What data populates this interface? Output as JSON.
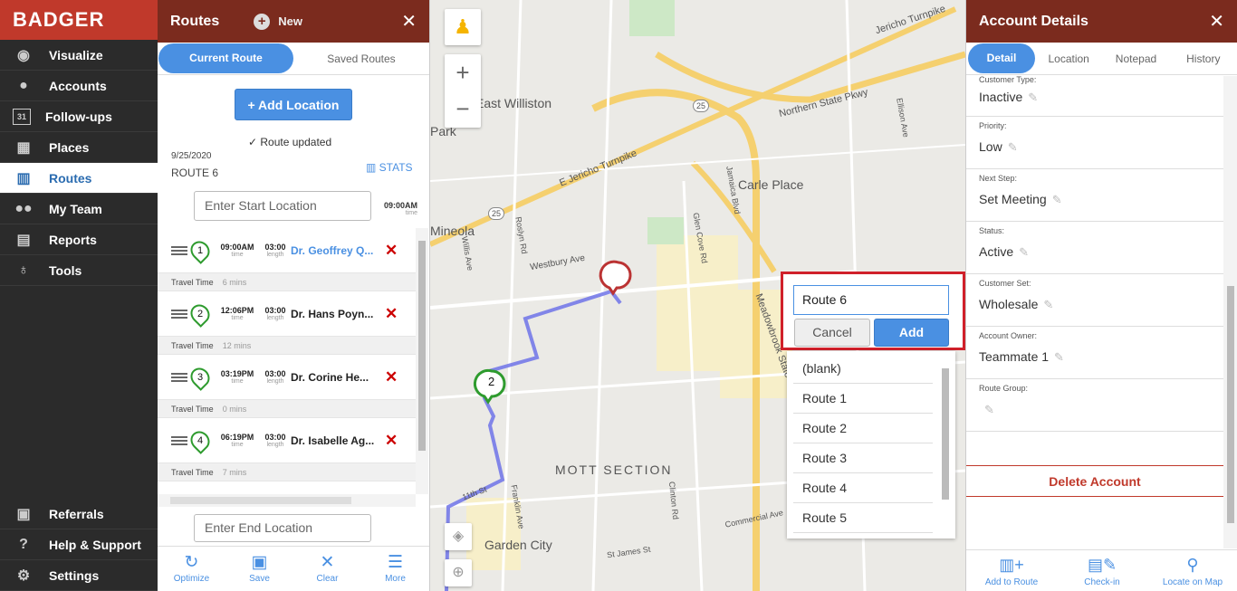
{
  "brand": "BADGER",
  "nav": {
    "items": [
      {
        "label": "Visualize",
        "icon": "eye-icon"
      },
      {
        "label": "Accounts",
        "icon": "person-icon"
      },
      {
        "label": "Follow-ups",
        "icon": "calendar-icon"
      },
      {
        "label": "Places",
        "icon": "store-icon"
      },
      {
        "label": "Routes",
        "icon": "map-icon"
      },
      {
        "label": "My Team",
        "icon": "team-icon"
      },
      {
        "label": "Reports",
        "icon": "report-icon"
      },
      {
        "label": "Tools",
        "icon": "tools-icon"
      }
    ],
    "bottom": [
      {
        "label": "Referrals",
        "icon": "gift-icon"
      },
      {
        "label": "Help & Support",
        "icon": "help-icon"
      },
      {
        "label": "Settings",
        "icon": "gear-icon"
      }
    ],
    "calendar_num": "31"
  },
  "routes_panel": {
    "title": "Routes",
    "new_label": "New",
    "tabs": [
      "Current Route",
      "Saved Routes"
    ],
    "add_location": "+ Add Location",
    "route_updated": "Route updated",
    "date": "9/25/2020",
    "route_name": "ROUTE 6",
    "stats": "STATS",
    "start_placeholder": "Enter Start Location",
    "start_time": "09:00AM",
    "time_label": "time",
    "length_label": "length",
    "travel_label": "Travel Time",
    "stops": [
      {
        "num": "1",
        "time": "09:00AM",
        "length": "03:00",
        "name": "Dr. Geoffrey Q...",
        "travel": "6 mins"
      },
      {
        "num": "2",
        "time": "12:06PM",
        "length": "03:00",
        "name": "Dr. Hans Poyn...",
        "travel": "12 mins"
      },
      {
        "num": "3",
        "time": "03:19PM",
        "length": "03:00",
        "name": "Dr. Corine He...",
        "travel": "0 mins"
      },
      {
        "num": "4",
        "time": "06:19PM",
        "length": "03:00",
        "name": "Dr. Isabelle Ag...",
        "travel": "7 mins"
      }
    ],
    "end_placeholder": "Enter End Location",
    "footer": [
      {
        "label": "Optimize",
        "icon": "optimize-icon"
      },
      {
        "label": "Save",
        "icon": "save-icon"
      },
      {
        "label": "Clear",
        "icon": "clear-icon"
      },
      {
        "label": "More",
        "icon": "menu-icon"
      }
    ]
  },
  "map": {
    "labels": [
      "East Williston",
      "Park",
      "Carle Place",
      "Mineola",
      "MOTT SECTION",
      "Garden City",
      "E Jericho Turnpike",
      "Northern State Pkwy",
      "Jericho Turnpike",
      "Westbury Ave",
      "Meadowbrook State",
      "Glen Cove Rd",
      "Jamaica Blvd",
      "Ellison Ave",
      "Willis Ave",
      "Roslyn Rd",
      "Clinton Rd",
      "Franklin Ave",
      "Commercial Ave",
      "St James St",
      "11th St",
      "25"
    ],
    "marker_2": "2"
  },
  "route_popup": {
    "input_value": "Route 6",
    "cancel": "Cancel",
    "add": "Add",
    "options": [
      "(blank)",
      "Route 1",
      "Route 2",
      "Route 3",
      "Route 4",
      "Route 5"
    ]
  },
  "account": {
    "title": "Account Details",
    "tabs": [
      "Detail",
      "Location",
      "Notepad",
      "History"
    ],
    "fields": [
      {
        "label": "Customer Type:",
        "value": "Inactive"
      },
      {
        "label": "Priority:",
        "value": "Low"
      },
      {
        "label": "Next Step:",
        "value": "Set Meeting"
      },
      {
        "label": "Status:",
        "value": "Active"
      },
      {
        "label": "Customer Set:",
        "value": "Wholesale"
      },
      {
        "label": "Account Owner:",
        "value": "Teammate 1"
      },
      {
        "label": "Route Group:",
        "value": ""
      }
    ],
    "delete": "Delete Account",
    "footer": [
      {
        "label": "Add to Route",
        "icon": "add-route-icon"
      },
      {
        "label": "Check-in",
        "icon": "checkin-icon"
      },
      {
        "label": "Locate on Map",
        "icon": "locate-icon"
      }
    ]
  },
  "colors": {
    "brand": "#c0392b",
    "header": "#7b2b1e",
    "accent": "#4a90e2",
    "nav_bg": "#2b2b2b",
    "highlight": "#d0202a"
  }
}
